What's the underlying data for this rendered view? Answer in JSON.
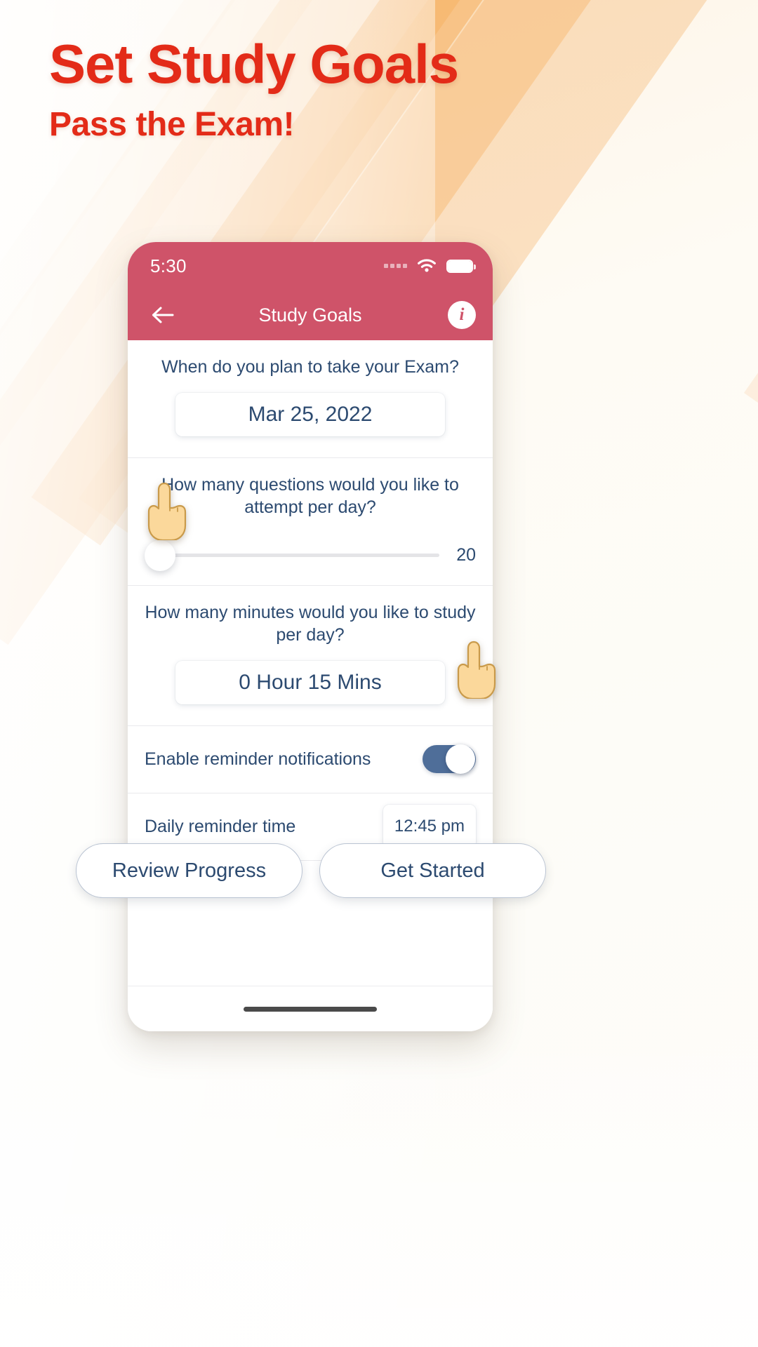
{
  "poster": {
    "headline": "Set Study Goals",
    "subheadline": "Pass the Exam!",
    "headline_color": "#e32b18",
    "background_accent": "#f4a046"
  },
  "phone": {
    "status_bar": {
      "time": "5:30",
      "signal_icon": "signal-dots-icon",
      "wifi_icon": "wifi-icon",
      "battery_icon": "battery-full-icon"
    },
    "nav_bar": {
      "back_icon": "arrow-left-icon",
      "title": "Study Goals",
      "info_icon": "info-icon",
      "info_label": "i",
      "background_color": "#cf5369"
    },
    "sections": {
      "exam_date": {
        "question": "When do you plan to take your Exam?",
        "value": "Mar 25, 2022"
      },
      "questions_per_day": {
        "question": "How many questions would you like to attempt per day?",
        "value": "20",
        "slider_position_percent": 0
      },
      "minutes_per_day": {
        "question": "How many minutes would you like to study per day?",
        "value": "0 Hour 15 Mins"
      },
      "reminder_toggle": {
        "label": "Enable reminder notifications",
        "state": "on",
        "track_color": "#4f6e99"
      },
      "reminder_time": {
        "label": "Daily reminder time",
        "value": "12:45 pm"
      }
    },
    "home_indicator": "home-indicator"
  },
  "cta": {
    "primary": "Review Progress",
    "secondary": "Get Started"
  },
  "cursors": {
    "slider_hand": "pointing-hand-icon",
    "toggle_hand": "pointing-hand-icon"
  }
}
